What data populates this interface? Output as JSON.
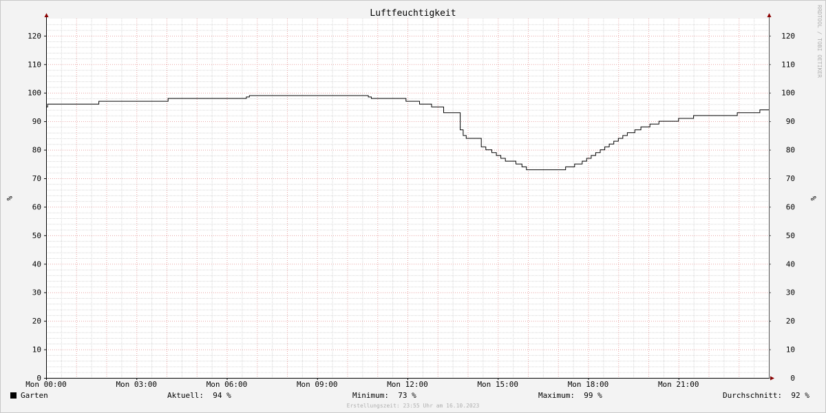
{
  "chart_data": {
    "type": "line",
    "title": "Luftfeuchtigkeit",
    "ylabel": "%",
    "ylabel_right": "%",
    "watermark": "RRDTOOL / TOBI OETIKER",
    "ylim": [
      0,
      126
    ],
    "xlim": [
      0,
      24
    ],
    "y_ticks": [
      0,
      10,
      20,
      30,
      40,
      50,
      60,
      70,
      80,
      90,
      100,
      110,
      120
    ],
    "x_ticks": [
      {
        "value": 0,
        "label": "Mon 00:00"
      },
      {
        "value": 3,
        "label": "Mon 03:00"
      },
      {
        "value": 6,
        "label": "Mon 06:00"
      },
      {
        "value": 9,
        "label": "Mon 09:00"
      },
      {
        "value": 12,
        "label": "Mon 12:00"
      },
      {
        "value": 15,
        "label": "Mon 15:00"
      },
      {
        "value": 18,
        "label": "Mon 18:00"
      },
      {
        "value": 21,
        "label": "Mon 21:00"
      }
    ],
    "grid": true,
    "series": [
      {
        "name": "Garten",
        "color": "#000000",
        "x": [
          0,
          0.05,
          1.75,
          4.05,
          6.65,
          6.75,
          10.7,
          10.8,
          11.95,
          12.4,
          12.8,
          13.2,
          13.75,
          13.85,
          13.95,
          14.45,
          14.6,
          14.8,
          14.95,
          15.1,
          15.25,
          15.35,
          15.6,
          15.8,
          15.95,
          16.1,
          17.25,
          17.55,
          17.8,
          17.95,
          18.1,
          18.25,
          18.4,
          18.55,
          18.7,
          18.85,
          19.0,
          19.15,
          19.3,
          19.55,
          19.75,
          20.05,
          20.35,
          21.0,
          21.5,
          22.25,
          22.95,
          23.7,
          24.0
        ],
        "y": [
          95,
          96,
          97,
          98,
          98.5,
          99,
          98.5,
          98,
          97,
          96,
          95,
          93,
          87,
          85,
          84,
          81,
          80,
          79,
          78,
          77,
          76,
          76,
          75,
          74,
          73,
          73,
          74,
          75,
          76,
          77,
          78,
          79,
          80,
          81,
          82,
          83,
          84,
          85,
          86,
          87,
          88,
          89,
          90,
          91,
          92,
          92,
          93,
          94,
          94
        ]
      }
    ]
  },
  "legend": {
    "series_name": "Garten",
    "current_label": "Aktuell:",
    "current_value": "94 %",
    "min_label": "Minimum:",
    "min_value": "73 %",
    "max_label": "Maximum:",
    "max_value": "99 %",
    "avg_label": "Durchschnitt:",
    "avg_value": "92 %"
  },
  "footer_text": "Erstellungszeit: 23:55 Uhr am 16.10.2023",
  "colors": {
    "background": "#f3f3f3",
    "plot_background": "#ffffff",
    "major_grid": "#e8a0a0",
    "minor_grid": "#d6d6d6",
    "axis": "#000000",
    "arrow": "#8b0000"
  }
}
